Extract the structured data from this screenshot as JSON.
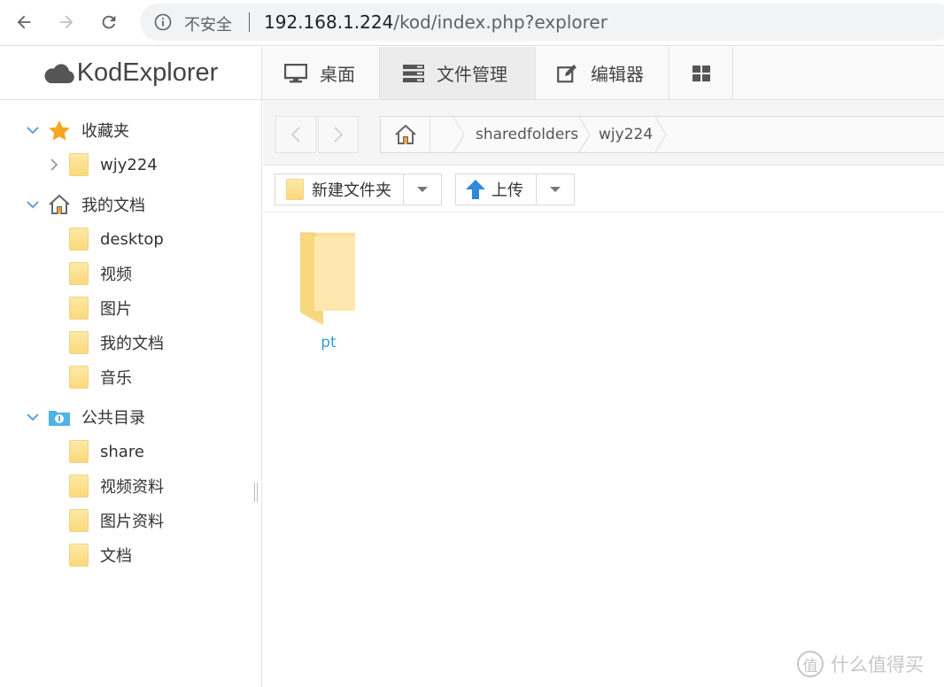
{
  "browser": {
    "security_label": "不安全",
    "url_host": "192.168.1.224",
    "url_path": "/kod/index.php?explorer"
  },
  "app": {
    "name": "KodExplorer"
  },
  "top_tabs": [
    {
      "label": "桌面",
      "icon": "monitor-icon"
    },
    {
      "label": "文件管理",
      "icon": "file-manager-icon",
      "active": true
    },
    {
      "label": "编辑器",
      "icon": "edit-icon"
    },
    {
      "label": "",
      "icon": "grid-icon"
    }
  ],
  "sidebar": {
    "favorites": {
      "label": "收藏夹",
      "items": [
        "wjy224"
      ]
    },
    "my_docs": {
      "label": "我的文档",
      "items": [
        "desktop",
        "视频",
        "图片",
        "我的文档",
        "音乐"
      ]
    },
    "public": {
      "label": "公共目录",
      "items": [
        "share",
        "视频资料",
        "图片资料",
        "文档"
      ]
    }
  },
  "breadcrumbs": [
    "sharedfolders",
    "wjy224"
  ],
  "toolbar": {
    "new_folder": "新建文件夹",
    "upload": "上传"
  },
  "files": [
    {
      "name": "pt",
      "type": "folder"
    }
  ],
  "watermark": {
    "icon_text": "值",
    "text": "什么值得买"
  },
  "colors": {
    "link": "#3a9bcc",
    "folder": "#fbd97b",
    "accent_blue": "#2f89d8"
  }
}
